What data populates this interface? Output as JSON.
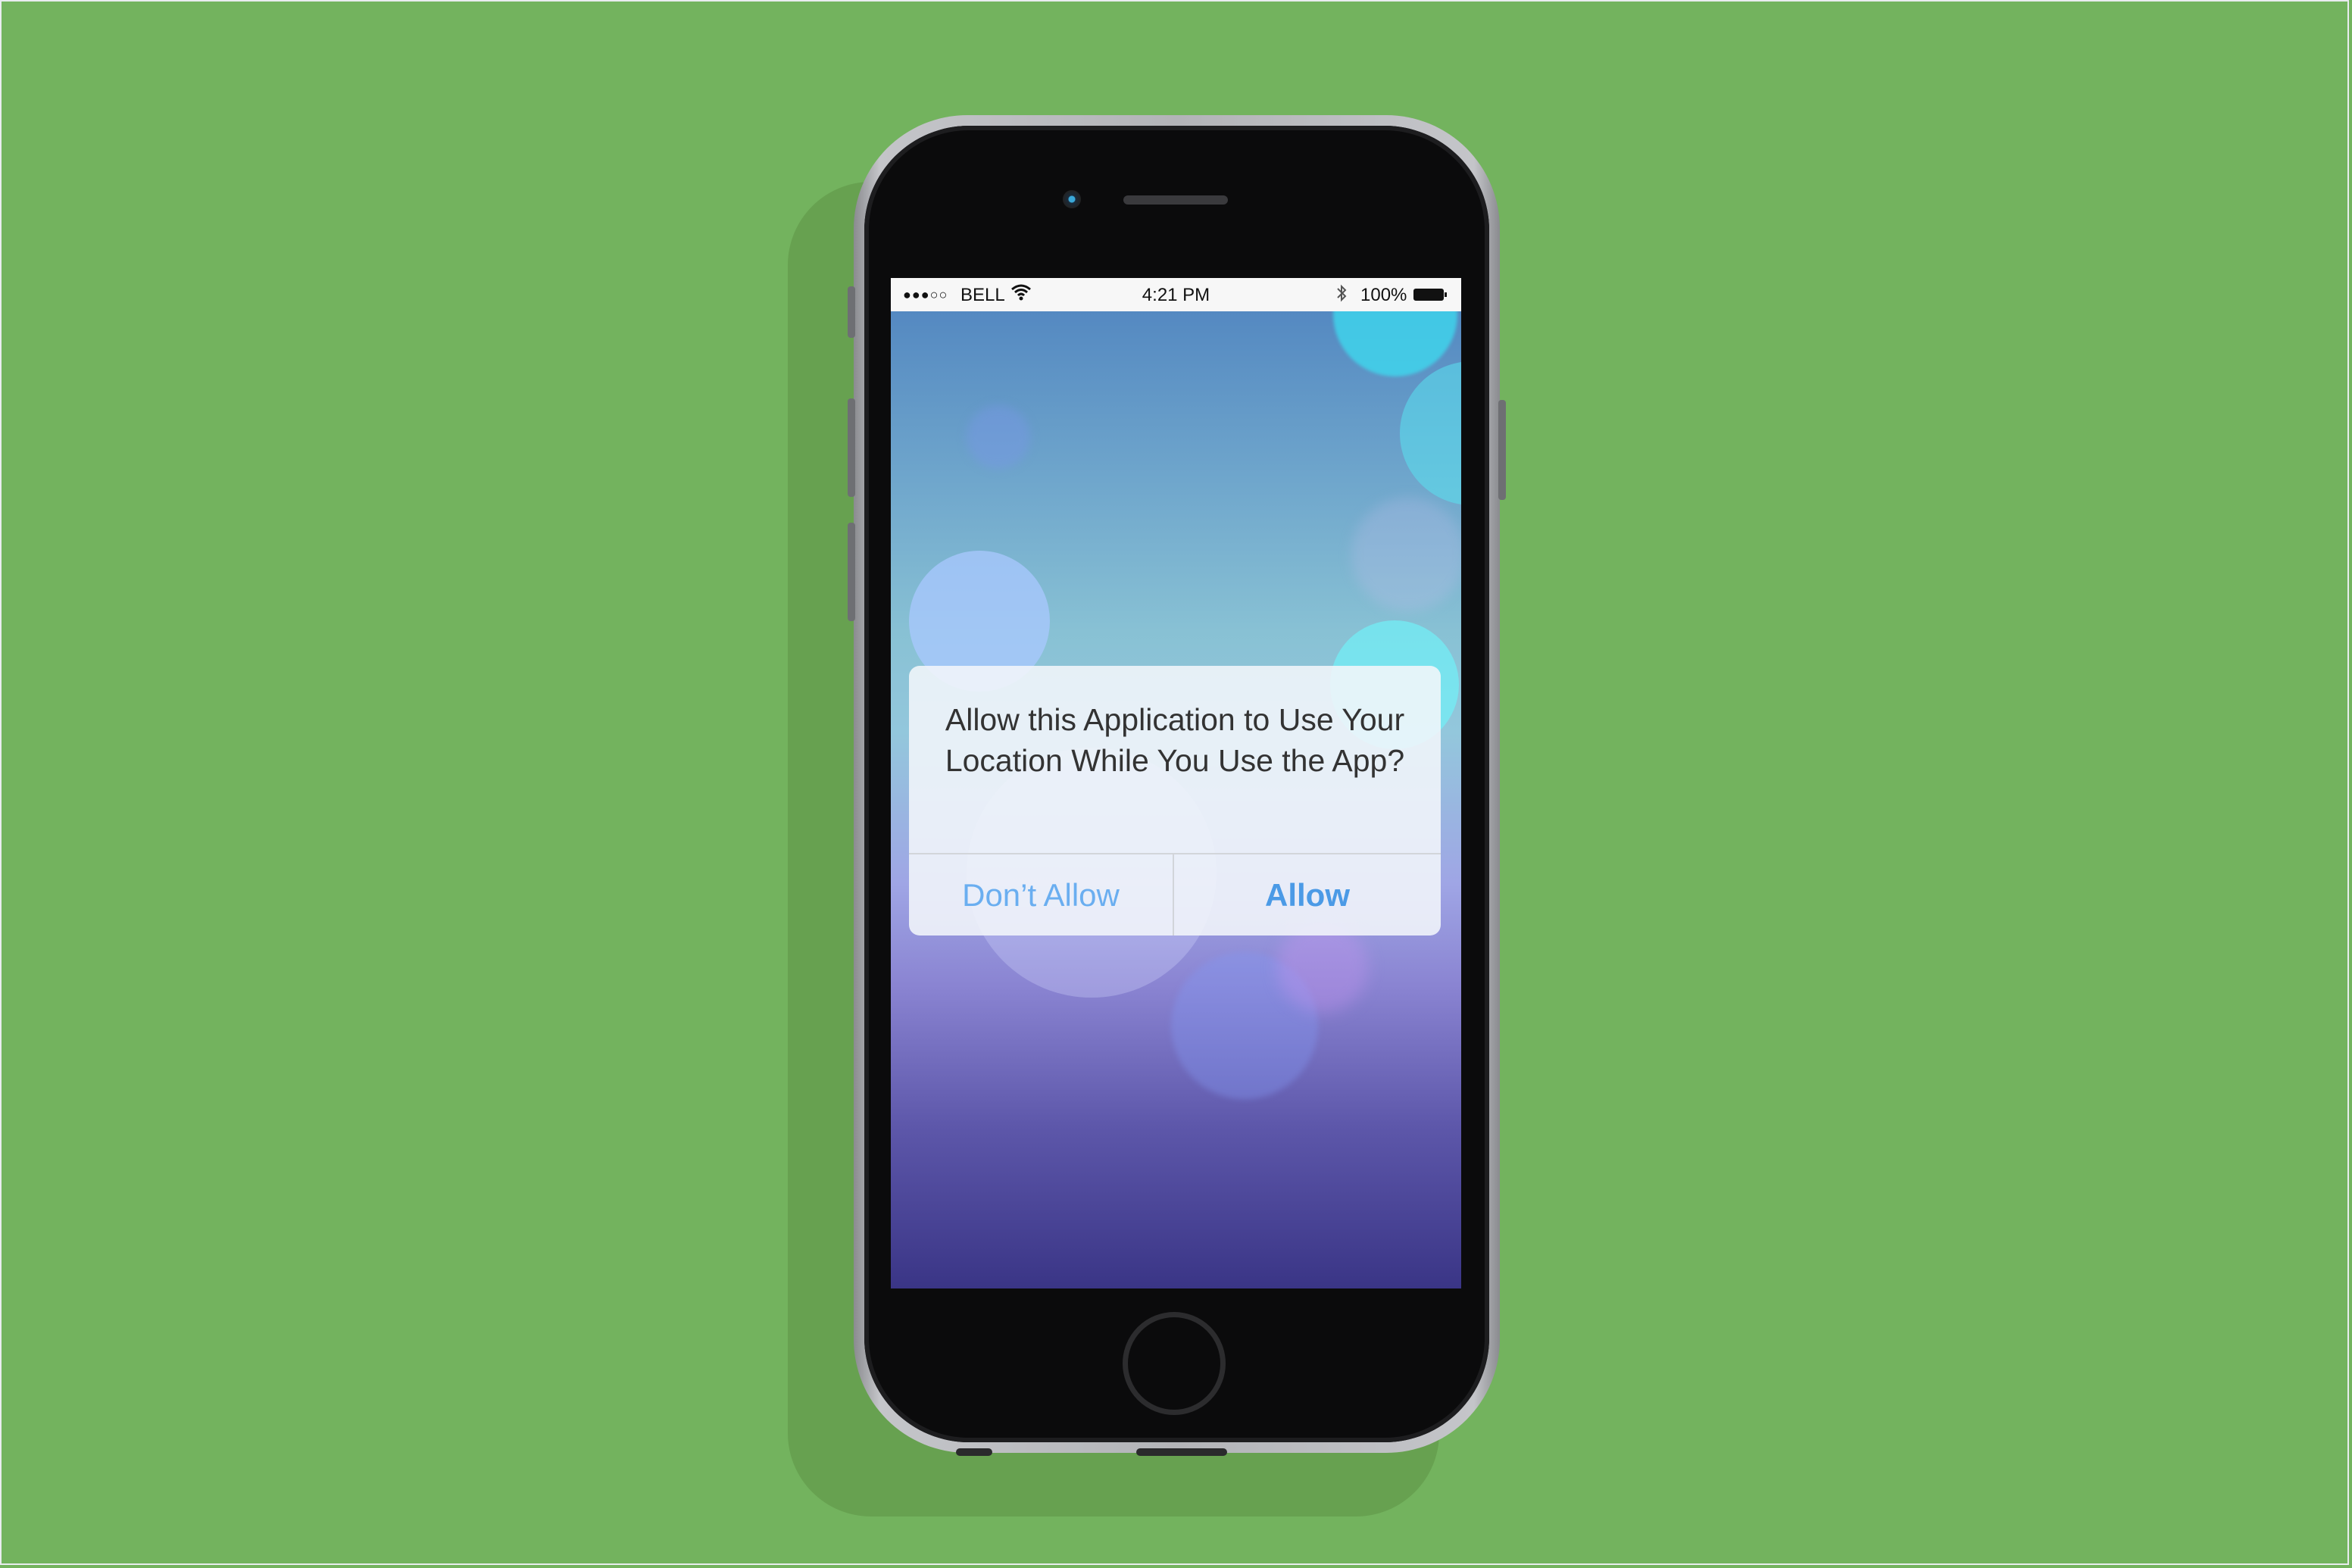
{
  "status_bar": {
    "signal": "●●●○○",
    "carrier": "BELL",
    "wifi_icon": "wifi-icon",
    "time": "4:21 PM",
    "bluetooth_icon": "bluetooth-icon",
    "battery_percent": "100%",
    "battery_icon": "battery-icon"
  },
  "alert": {
    "title": "Allow this Application to Use Your Location While You Use the App?",
    "deny_label": "Don’t Allow",
    "allow_label": "Allow"
  },
  "colors": {
    "background": "#73b35e",
    "accent": "#4b9ae6"
  }
}
